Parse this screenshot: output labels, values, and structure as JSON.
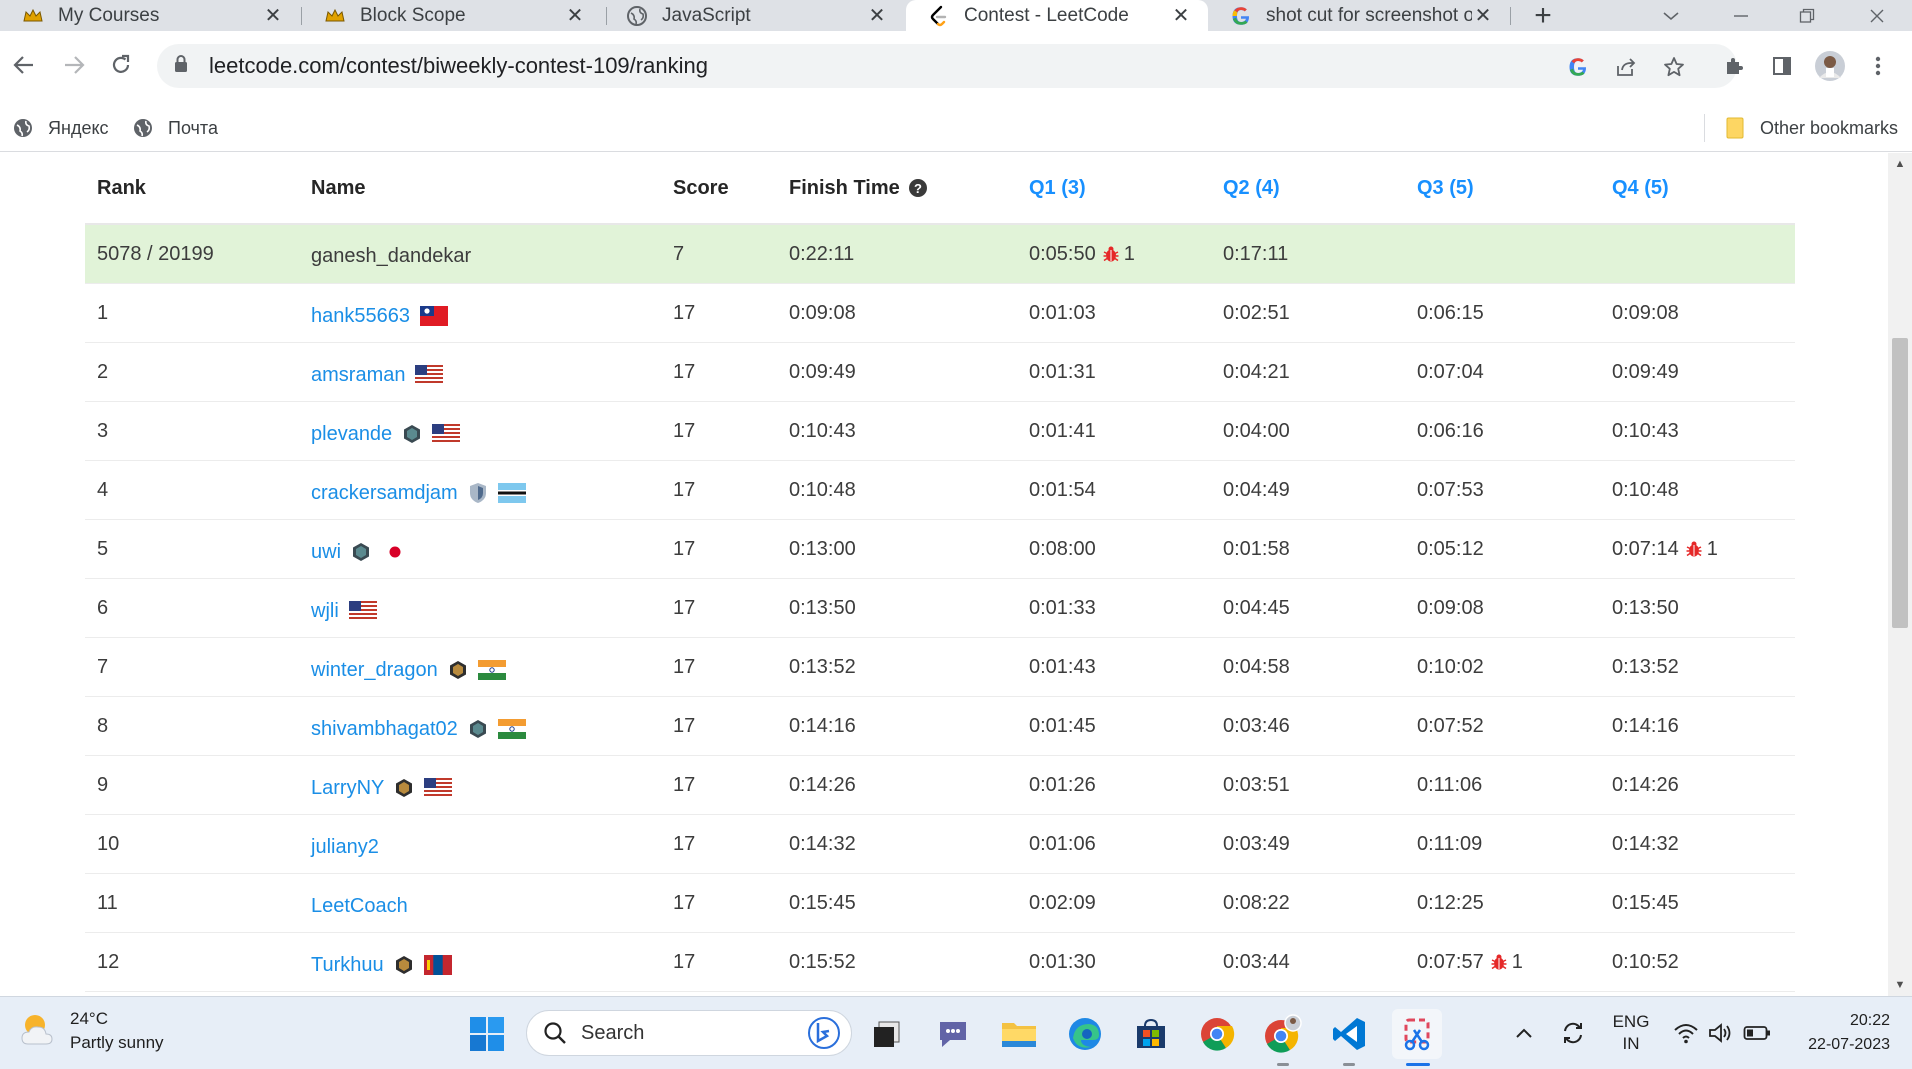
{
  "browser": {
    "tabs": [
      {
        "label": "My Courses",
        "icon": "crown-icon",
        "active": false
      },
      {
        "label": "Block Scope",
        "icon": "crown-icon",
        "active": false
      },
      {
        "label": "JavaScript",
        "icon": "globe-icon",
        "active": false
      },
      {
        "label": "Contest - LeetCode",
        "icon": "leetcode-icon",
        "active": true
      },
      {
        "label": "shot cut for screenshot or",
        "icon": "google-icon",
        "active": false
      }
    ],
    "url": "leetcode.com/contest/biweekly-contest-109/ranking",
    "bookmarks": [
      {
        "label": "Яндекс",
        "icon": "globe-icon"
      },
      {
        "label": "Почта",
        "icon": "globe-icon"
      }
    ],
    "other_bookmarks": "Other bookmarks"
  },
  "ranking": {
    "headers": {
      "rank": "Rank",
      "name": "Name",
      "score": "Score",
      "finish": "Finish Time",
      "q1": "Q1 (3)",
      "q2": "Q2 (4)",
      "q3": "Q3 (5)",
      "q4": "Q4 (5)"
    },
    "me": {
      "rank": "5078 / 20199",
      "name": "ganesh_dandekar",
      "score": "7",
      "finish": "0:22:11",
      "q1": "0:05:50",
      "q1_bugs": "1",
      "q2": "0:17:11",
      "q3": "",
      "q4": ""
    },
    "rows": [
      {
        "rank": "1",
        "name": "hank55663",
        "badge": "",
        "flag": "tw",
        "score": "17",
        "finish": "0:09:08",
        "q1": "0:01:03",
        "q2": "0:02:51",
        "q3": "0:06:15",
        "q4": "0:09:08",
        "q3_bugs": "",
        "q4_bugs": ""
      },
      {
        "rank": "2",
        "name": "amsraman",
        "badge": "",
        "flag": "us",
        "score": "17",
        "finish": "0:09:49",
        "q1": "0:01:31",
        "q2": "0:04:21",
        "q3": "0:07:04",
        "q4": "0:09:49",
        "q3_bugs": "",
        "q4_bugs": ""
      },
      {
        "rank": "3",
        "name": "plevande",
        "badge": "guardian",
        "flag": "us",
        "score": "17",
        "finish": "0:10:43",
        "q1": "0:01:41",
        "q2": "0:04:00",
        "q3": "0:06:16",
        "q4": "0:10:43",
        "q3_bugs": "",
        "q4_bugs": ""
      },
      {
        "rank": "4",
        "name": "crackersamdjam",
        "badge": "knight",
        "flag": "bw",
        "score": "17",
        "finish": "0:10:48",
        "q1": "0:01:54",
        "q2": "0:04:49",
        "q3": "0:07:53",
        "q4": "0:10:48",
        "q3_bugs": "",
        "q4_bugs": ""
      },
      {
        "rank": "5",
        "name": "uwi",
        "badge": "guardian",
        "flag": "jp",
        "score": "17",
        "finish": "0:13:00",
        "q1": "0:08:00",
        "q2": "0:01:58",
        "q3": "0:05:12",
        "q4": "0:07:14",
        "q3_bugs": "",
        "q4_bugs": "1"
      },
      {
        "rank": "6",
        "name": "wjli",
        "badge": "",
        "flag": "us",
        "score": "17",
        "finish": "0:13:50",
        "q1": "0:01:33",
        "q2": "0:04:45",
        "q3": "0:09:08",
        "q4": "0:13:50",
        "q3_bugs": "",
        "q4_bugs": ""
      },
      {
        "rank": "7",
        "name": "winter_dragon",
        "badge": "guardian-gold",
        "flag": "in",
        "score": "17",
        "finish": "0:13:52",
        "q1": "0:01:43",
        "q2": "0:04:58",
        "q3": "0:10:02",
        "q4": "0:13:52",
        "q3_bugs": "",
        "q4_bugs": ""
      },
      {
        "rank": "8",
        "name": "shivambhagat02",
        "badge": "guardian",
        "flag": "in",
        "score": "17",
        "finish": "0:14:16",
        "q1": "0:01:45",
        "q2": "0:03:46",
        "q3": "0:07:52",
        "q4": "0:14:16",
        "q3_bugs": "",
        "q4_bugs": ""
      },
      {
        "rank": "9",
        "name": "LarryNY",
        "badge": "guardian-gold",
        "flag": "us",
        "score": "17",
        "finish": "0:14:26",
        "q1": "0:01:26",
        "q2": "0:03:51",
        "q3": "0:11:06",
        "q4": "0:14:26",
        "q3_bugs": "",
        "q4_bugs": ""
      },
      {
        "rank": "10",
        "name": "juliany2",
        "badge": "",
        "flag": "",
        "score": "17",
        "finish": "0:14:32",
        "q1": "0:01:06",
        "q2": "0:03:49",
        "q3": "0:11:09",
        "q4": "0:14:32",
        "q3_bugs": "",
        "q4_bugs": ""
      },
      {
        "rank": "11",
        "name": "LeetCoach",
        "badge": "",
        "flag": "",
        "score": "17",
        "finish": "0:15:45",
        "q1": "0:02:09",
        "q2": "0:08:22",
        "q3": "0:12:25",
        "q4": "0:15:45",
        "q3_bugs": "",
        "q4_bugs": ""
      },
      {
        "rank": "12",
        "name": "Turkhuu",
        "badge": "guardian-gold",
        "flag": "mn",
        "score": "17",
        "finish": "0:15:52",
        "q1": "0:01:30",
        "q2": "0:03:44",
        "q3": "0:07:57",
        "q4": "0:10:52",
        "q3_bugs": "1",
        "q4_bugs": ""
      }
    ]
  },
  "taskbar": {
    "weather_temp": "24°C",
    "weather_desc": "Partly sunny",
    "search_placeholder": "Search",
    "lang_line1": "ENG",
    "lang_line2": "IN",
    "time": "20:22",
    "date": "22-07-2023"
  },
  "colors": {
    "accent_blue": "#1890ff",
    "user_link": "#1a8ee6",
    "my_row_bg": "#e1f3d8",
    "bug_red": "#e52828"
  }
}
